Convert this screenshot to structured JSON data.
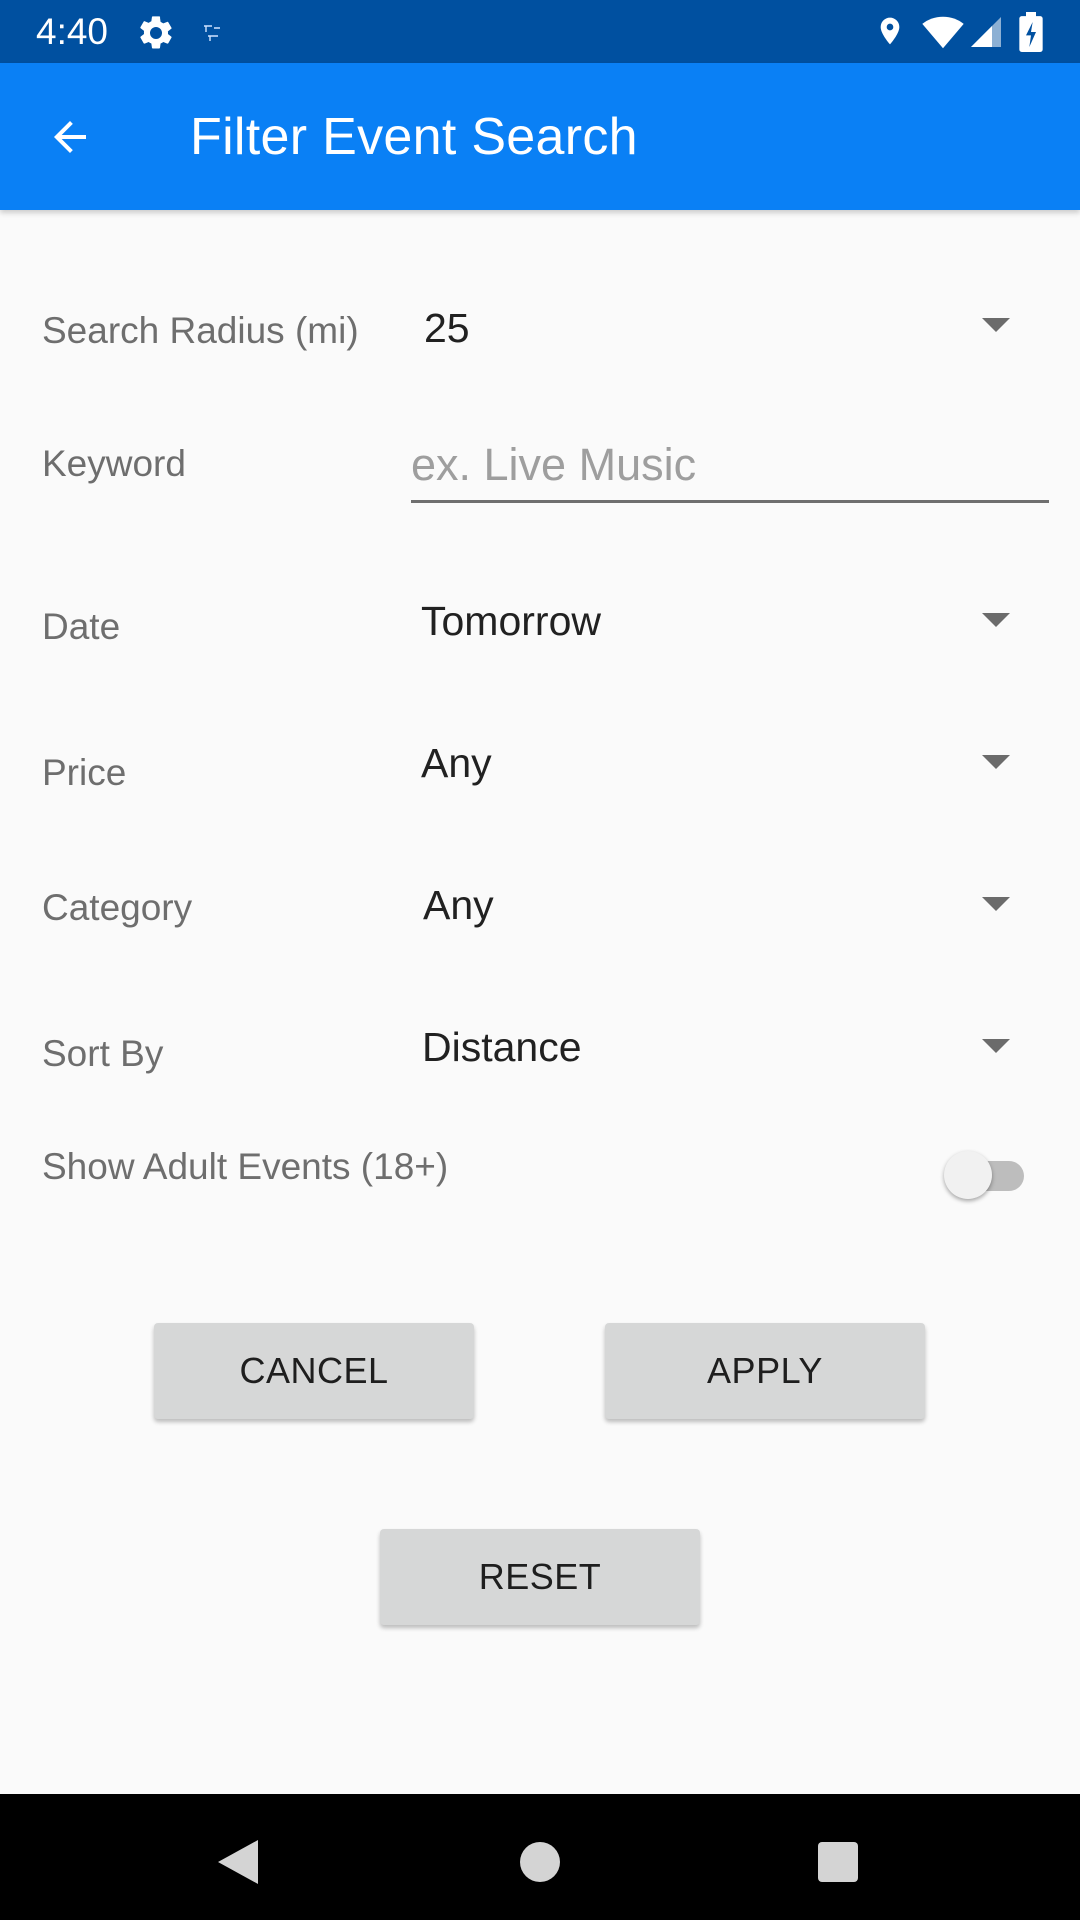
{
  "status_bar": {
    "time": "4:40",
    "icons": [
      "gear-icon",
      "app-logo-icon",
      "location-icon",
      "wifi-icon",
      "signal-icon",
      "battery-charging-icon"
    ]
  },
  "app_bar": {
    "title": "Filter Event Search",
    "back_icon": "arrow-back-icon",
    "color": "#0a80f5"
  },
  "form": {
    "radius": {
      "label": "Search Radius (mi)",
      "value": "25"
    },
    "keyword": {
      "label": "Keyword",
      "placeholder": "ex. Live Music",
      "value": ""
    },
    "date": {
      "label": "Date",
      "value": "Tomorrow"
    },
    "price": {
      "label": "Price",
      "value": "Any"
    },
    "category": {
      "label": "Category",
      "value": "Any"
    },
    "sort_by": {
      "label": "Sort By",
      "value": "Distance"
    },
    "adult": {
      "label": "Show Adult Events (18+)",
      "enabled": false
    }
  },
  "buttons": {
    "cancel": "CANCEL",
    "apply": "APPLY",
    "reset": "RESET"
  },
  "nav_bar": {
    "icons": [
      "nav-back-icon",
      "nav-home-icon",
      "nav-recents-icon"
    ]
  }
}
